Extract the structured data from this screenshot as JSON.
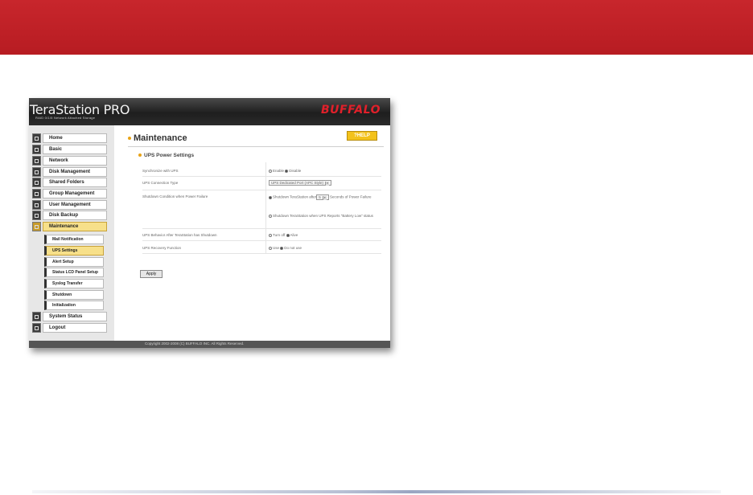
{
  "header": {
    "logo_main": "TeraStation PRO",
    "logo_sub": "RAID 0/1/5 Network Attached Storage",
    "brand": "BUFFALO"
  },
  "sidebar": {
    "items": [
      {
        "label": "Home"
      },
      {
        "label": "Basic"
      },
      {
        "label": "Network"
      },
      {
        "label": "Disk Management"
      },
      {
        "label": "Shared Folders"
      },
      {
        "label": "Group Management"
      },
      {
        "label": "User Management"
      },
      {
        "label": "Disk Backup"
      },
      {
        "label": "Maintenance"
      }
    ],
    "subitems": [
      {
        "label": "Mail Notification"
      },
      {
        "label": "UPS Settings"
      },
      {
        "label": "Alert Setup"
      },
      {
        "label": "Status LCD Panel Setup"
      },
      {
        "label": "Syslog Transfer"
      },
      {
        "label": "Shutdown"
      },
      {
        "label": "Initialization"
      }
    ],
    "bottom_items": [
      {
        "label": "System Status"
      },
      {
        "label": "Logout"
      }
    ]
  },
  "main": {
    "title": "Maintenance",
    "help_label": "?HELP",
    "section_title": "UPS Power Settings",
    "rows": {
      "sync_label": "Synchronize with UPS",
      "sync_enable": "Enable",
      "sync_disable": "Disable",
      "conn_label": "UPS Connection Type",
      "conn_value": "UPS Dedicated Port (APC Style)",
      "shutdown_label": "Shutdown Condition when Power Failure",
      "shutdown_opt1_a": "Shutdown TeraStation after",
      "shutdown_seconds": "5",
      "shutdown_opt1_b": "Seconds of Power Failure",
      "shutdown_opt2": "Shutdown TeraStation when UPS Reports \"Battery Low\" status",
      "behavior_label": "UPS Behavior After TeraStation has Shutdown",
      "behavior_off": "Turn off",
      "behavior_alive": "Alive",
      "recovery_label": "UPS Recovery Function",
      "recovery_use": "Use",
      "recovery_not": "Do not use"
    },
    "apply_label": "Apply"
  },
  "footer": {
    "copyright": "Copyright 2002-2008 (C) BUFFALO INC. All Rights Reserved."
  },
  "colors": {
    "banner_red": "#c8262c",
    "active_yellow": "#f7e08a",
    "help_yellow": "#f3c21b",
    "brand_red": "#e0202a"
  }
}
